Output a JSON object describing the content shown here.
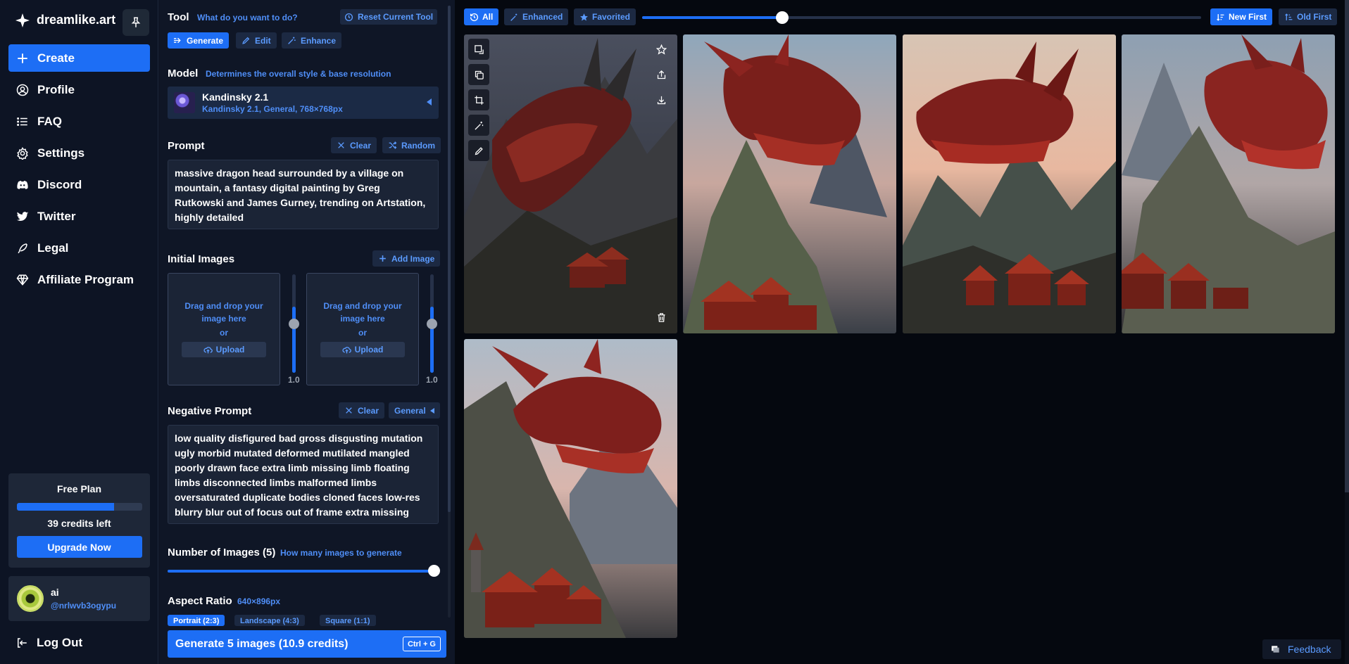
{
  "brand": {
    "name": "dreamlike.art"
  },
  "sidebar": {
    "items": [
      {
        "label": "Create",
        "icon": "plus-icon"
      },
      {
        "label": "Profile",
        "icon": "user-circle-icon"
      },
      {
        "label": "FAQ",
        "icon": "list-icon"
      },
      {
        "label": "Settings",
        "icon": "gear-icon"
      },
      {
        "label": "Discord",
        "icon": "discord-icon"
      },
      {
        "label": "Twitter",
        "icon": "twitter-icon"
      },
      {
        "label": "Legal",
        "icon": "feather-icon"
      },
      {
        "label": "Affiliate Program",
        "icon": "diamond-icon"
      }
    ],
    "plan": {
      "title": "Free Plan",
      "credits_text": "39 credits left",
      "progress": 0.78,
      "upgrade_label": "Upgrade Now"
    },
    "user": {
      "name": "ai",
      "handle": "@nrlwvb3ogypu"
    },
    "logout_label": "Log Out"
  },
  "panel": {
    "tool": {
      "label": "Tool",
      "hint": "What do you want to do?",
      "reset_label": "Reset Current Tool",
      "tabs": [
        "Generate",
        "Edit",
        "Enhance"
      ],
      "active_tab": "Generate"
    },
    "model": {
      "label": "Model",
      "hint": "Determines the overall style & base resolution",
      "name": "Kandinsky 2.1",
      "desc": "Kandinsky 2.1, General, 768×768px"
    },
    "prompt": {
      "label": "Prompt",
      "clear_label": "Clear",
      "random_label": "Random",
      "value": "massive dragon head surrounded by a village on mountain, a fantasy digital painting by Greg Rutkowski and James Gurney, trending on Artstation, highly detailed"
    },
    "initial_images": {
      "label": "Initial Images",
      "add_label": "Add Image",
      "dropzones": [
        {
          "text": "Drag and drop your image here",
          "or": "or",
          "upload": "Upload",
          "strength": "1.0"
        },
        {
          "text": "Drag and drop your image here",
          "or": "or",
          "upload": "Upload",
          "strength": "1.0"
        }
      ]
    },
    "negative_prompt": {
      "label": "Negative Prompt",
      "clear_label": "Clear",
      "preset_label": "General",
      "value": "low quality disfigured bad gross disgusting mutation ugly morbid mutated deformed mutilated mangled poorly drawn face extra limb missing limb floating limbs disconnected limbs malformed limbs oversaturated duplicate bodies cloned faces low-res blurry blur out of focus out of frame extra missing"
    },
    "num_images": {
      "label": "Number of Images (5)",
      "hint": "How many images to generate",
      "value": 5,
      "max": 5
    },
    "aspect_ratio": {
      "label": "Aspect Ratio",
      "hint": "640×896px",
      "options": [
        "Portrait (2:3)",
        "Landscape (4:3)",
        "Square (1:1)"
      ],
      "selected": "Portrait (2:3)"
    },
    "generate": {
      "label": "Generate 5 images (10.9 credits)",
      "shortcut": "Ctrl + G"
    }
  },
  "gallery": {
    "filters": [
      "All",
      "Enhanced",
      "Favorited"
    ],
    "active_filter": "All",
    "sort": [
      "New First",
      "Old First"
    ],
    "active_sort": "New First",
    "size_slider": 0.25,
    "images": [
      {
        "alt": "dragon-image-1"
      },
      {
        "alt": "dragon-image-2"
      },
      {
        "alt": "dragon-image-3"
      },
      {
        "alt": "dragon-image-4"
      },
      {
        "alt": "dragon-image-5"
      }
    ],
    "feedback_label": "Feedback"
  },
  "colors": {
    "accent": "#1d6ef5",
    "link": "#4f8ef7",
    "sidebar_bg": "#0d1424",
    "panel_bg": "#0f1626",
    "gallery_bg": "#05080f"
  }
}
